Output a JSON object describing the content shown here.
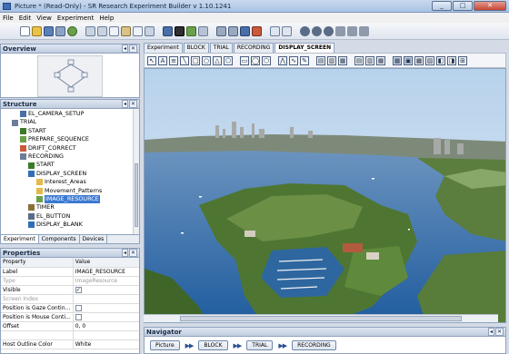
{
  "window": {
    "title": "Picture * (Read-Only) - SR Research Experiment Builder v 1.10.1241",
    "minimize_label": "_",
    "maximize_label": "□",
    "close_label": "✕"
  },
  "menu": {
    "items": [
      "File",
      "Edit",
      "View",
      "Experiment",
      "Help"
    ]
  },
  "overview": {
    "title": "Overview"
  },
  "structure": {
    "title": "Structure",
    "nodes": [
      {
        "label": "EL_CAMERA_SETUP",
        "level": 3,
        "icon": "camera-setup-icon"
      },
      {
        "label": "TRIAL",
        "level": 2,
        "icon": "sequence-icon"
      },
      {
        "label": "START",
        "level": 3,
        "icon": "start-icon"
      },
      {
        "label": "PREPARE_SEQUENCE",
        "level": 3,
        "icon": "prepare-sequence-icon"
      },
      {
        "label": "DRIFT_CORRECT",
        "level": 3,
        "icon": "drift-correct-icon"
      },
      {
        "label": "RECORDING",
        "level": 3,
        "icon": "sequence-icon"
      },
      {
        "label": "START",
        "level": 4,
        "icon": "start-icon"
      },
      {
        "label": "DISPLAY_SCREEN",
        "level": 4,
        "icon": "display-screen-icon"
      },
      {
        "label": "Interest_Areas",
        "level": 5,
        "icon": "folder-icon"
      },
      {
        "label": "Movement_Patterns",
        "level": 5,
        "icon": "folder-icon"
      },
      {
        "label": "IMAGE_RESOURCE",
        "level": 5,
        "icon": "image-resource-icon",
        "selected": true
      },
      {
        "label": "TIMER",
        "level": 4,
        "icon": "timer-icon"
      },
      {
        "label": "EL_BUTTON",
        "level": 4,
        "icon": "button-icon"
      },
      {
        "label": "DISPLAY_BLANK",
        "level": 4,
        "icon": "display-screen-icon"
      }
    ],
    "tabs": [
      "Experiment",
      "Components",
      "Devices"
    ]
  },
  "properties": {
    "title": "Properties",
    "headers": {
      "property": "Property",
      "value": "Value"
    },
    "rows": [
      {
        "property": "Label",
        "value": "IMAGE_RESOURCE"
      },
      {
        "property": "Type",
        "value": "ImageResource",
        "gray": true
      },
      {
        "property": "Visible",
        "checkbox": true,
        "checked": true
      },
      {
        "property": "Screen Index",
        "value": "",
        "gray": true
      },
      {
        "property": "Position is Gaze Contin...",
        "checkbox": true,
        "checked": false
      },
      {
        "property": "Position is Mouse Conti...",
        "checkbox": true,
        "checked": false
      },
      {
        "property": "Offset",
        "value": "0, 0"
      },
      {
        "property": "",
        "value": ""
      },
      {
        "property": "Host Outline Color",
        "value": "White"
      }
    ]
  },
  "editor": {
    "tabs": [
      "Experiment",
      "BLOCK",
      "TRIAL",
      "RECORDING",
      "DISPLAY_SCREEN"
    ],
    "active_tab": "DISPLAY_SCREEN"
  },
  "navigator": {
    "title": "Navigator",
    "crumbs": [
      "Picture",
      "BLOCK",
      "TRIAL",
      "RECORDING"
    ]
  },
  "colors": {
    "accent": "#3b79d1",
    "panel_border": "#8fa2bd",
    "water": "#2f6fb4",
    "foliage": "#4f7a35",
    "sky": "#bcd6ee"
  }
}
